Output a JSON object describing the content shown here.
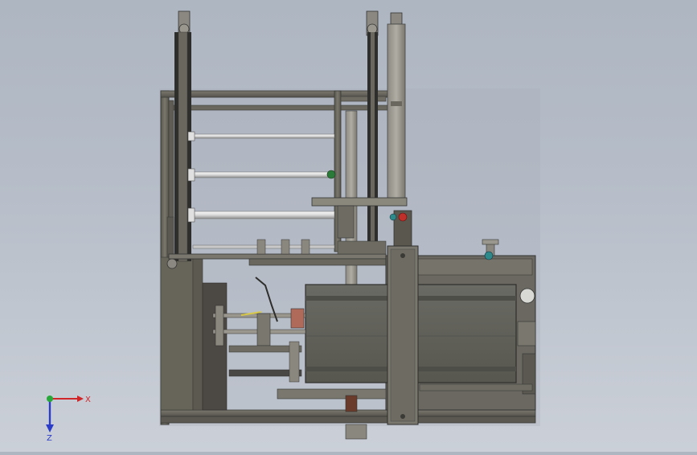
{
  "viewport": {
    "background_top": "#aeb6c2",
    "background_bottom": "#cbd0d8"
  },
  "model": {
    "frame_color": "#6e6c62",
    "frame_dark": "#3c3c38",
    "roller_color": "#e8e8e8",
    "accent_red": "#c0302a",
    "accent_teal": "#2e8a8a",
    "accent_yellow": "#d8c84a"
  },
  "triad": {
    "x_label": "X",
    "z_label": "Z",
    "x_color": "#d0262a",
    "y_color": "#28a83a",
    "z_color": "#2a3cc8"
  }
}
